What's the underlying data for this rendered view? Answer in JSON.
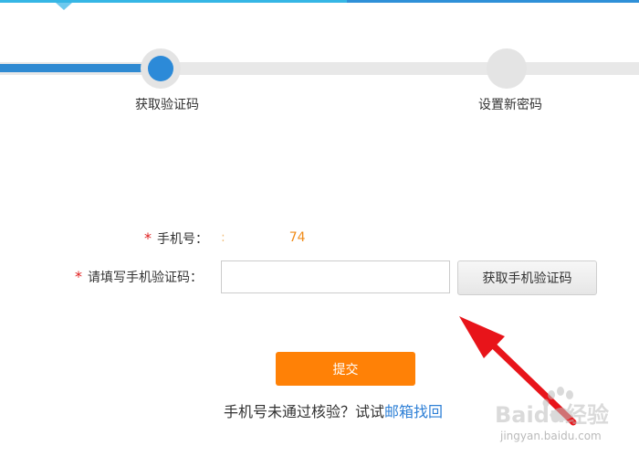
{
  "steps": [
    {
      "label": "获取验证码",
      "state": "active"
    },
    {
      "label": "设置新密码",
      "state": "inactive"
    }
  ],
  "form": {
    "required_mark": "*",
    "phone_label": "手机号：",
    "phone_prefix": ":",
    "phone_value": "74",
    "code_label": "请填写手机验证码：",
    "code_value": "",
    "get_code_label": "获取手机验证码",
    "submit_label": "提交"
  },
  "fallback": {
    "text": "手机号未通过核验？试试",
    "link_label": "邮箱找回"
  },
  "watermark": {
    "brand": "Baidu经验",
    "url": "jingyan.baidu.com"
  },
  "colors": {
    "progress_blue": "#2f8ad2",
    "submit_orange": "#ff8106",
    "required_red": "#e02020",
    "link_blue": "#2d7fd6",
    "annotation_arrow": "#e8141a"
  }
}
